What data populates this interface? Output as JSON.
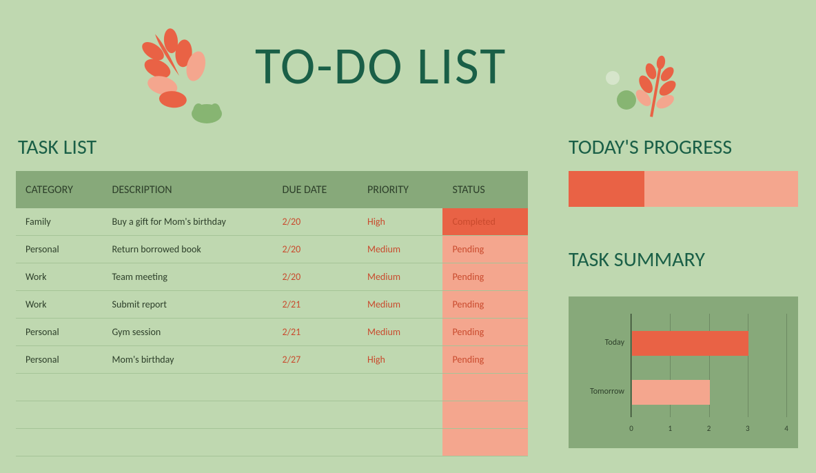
{
  "header": {
    "title": "TO-DO LIST"
  },
  "task_list": {
    "title": "TASK LIST",
    "columns": [
      "CATEGORY",
      "DESCRIPTION",
      "DUE DATE",
      "PRIORITY",
      "STATUS"
    ],
    "rows": [
      {
        "category": "Family",
        "description": "Buy a gift for Mom's birthday",
        "due": "2/20",
        "priority": "High",
        "status": "Completed"
      },
      {
        "category": "Personal",
        "description": "Return borrowed book",
        "due": "2/20",
        "priority": "Medium",
        "status": "Pending"
      },
      {
        "category": "Work",
        "description": "Team meeting",
        "due": "2/20",
        "priority": "Medium",
        "status": "Pending"
      },
      {
        "category": "Work",
        "description": "Submit report",
        "due": "2/21",
        "priority": "Medium",
        "status": "Pending"
      },
      {
        "category": "Personal",
        "description": "Gym session",
        "due": "2/21",
        "priority": "Medium",
        "status": "Pending"
      },
      {
        "category": "Personal",
        "description": "Mom's birthday",
        "due": "2/27",
        "priority": "High",
        "status": "Pending"
      }
    ],
    "empty_status_rows": 3
  },
  "progress": {
    "title": "TODAY'S PROGRESS",
    "percent": 33
  },
  "summary": {
    "title": "TASK SUMMARY"
  },
  "chart_data": {
    "type": "bar",
    "orientation": "horizontal",
    "categories": [
      "Today",
      "Tomorrow"
    ],
    "values": [
      3,
      2
    ],
    "xlim": [
      0,
      4
    ],
    "xticks": [
      0,
      1,
      2,
      3,
      4
    ],
    "colors": [
      "#e96245",
      "#f4a68e"
    ]
  }
}
